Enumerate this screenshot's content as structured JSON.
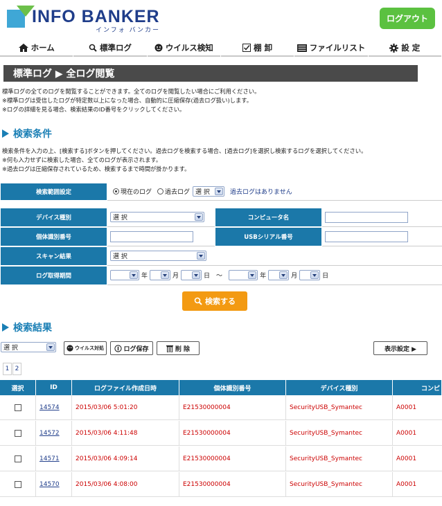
{
  "header": {
    "logo_main": "INFO BANKER",
    "logo_sub": "インフォ バンカー",
    "logout": "ログアウト"
  },
  "nav": [
    {
      "label": "ホーム",
      "icon": "home-icon"
    },
    {
      "label": "標準ログ",
      "icon": "search-icon"
    },
    {
      "label": "ウイルス検知",
      "icon": "smiley-icon"
    },
    {
      "label": "棚 卸",
      "icon": "checkbox-icon"
    },
    {
      "label": "ファイルリスト",
      "icon": "list-icon"
    },
    {
      "label": "設 定",
      "icon": "gear-icon"
    }
  ],
  "page": {
    "title": "標準ログ ▶ 全ログ閲覧",
    "desc": [
      "標準ログの全てのログを閲覧することができます。全てのログを閲覧したい場合にご利用ください。",
      "※標準ログは受信したログが特定数以上になった場合、自動的に圧縮保存(過去ログ扱い)します。",
      "※ログの詳細を見る場合、検索結果のID番号をクリックしてください。"
    ]
  },
  "conditions": {
    "title": "検索条件",
    "desc": [
      "検索条件を入力の上、[検索する]ボタンを押してください。過去ログを検索する場合、[過去ログ]を選択し検索するログを選択してください。",
      "※何も入力せずに検索した場合、全てのログが表示されます。",
      "※過去ログは圧縮保存されているため、検索するまで時間が掛かります。"
    ],
    "range_label": "検索範囲設定",
    "radio_current": "現在のログ",
    "radio_past": "過去ログ",
    "past_select": "選 択",
    "no_past": "過去ログはありません",
    "device_label": "デバイス種別",
    "device_select": "選 択",
    "computer_label": "コンピュータ名",
    "individual_label": "個体識別番号",
    "usb_label": "USBシリアル番号",
    "scan_label": "スキャン結果",
    "scan_select": "選 択",
    "period_label": "ログ取得期間",
    "year": "年",
    "month": "月",
    "day": "日",
    "tilde": "～",
    "search_btn": "検索する"
  },
  "results": {
    "title": "検索結果",
    "bulk_select": "選 択",
    "virus_btn": "ウイルス対処",
    "save_btn": "ログ保存",
    "delete_btn": "削 除",
    "display_btn": "表示設定 ▶",
    "pages": [
      "1",
      "2"
    ],
    "columns": [
      "選択",
      "ID",
      "ログファイル作成日時",
      "個体識別番号",
      "デバイス種別",
      "コンピ"
    ],
    "rows": [
      {
        "id": "14574",
        "date": "2015/03/06 5:01:20",
        "serial": "E21530000004",
        "device": "SecurityUSB_Symantec",
        "pc": "A0001"
      },
      {
        "id": "14572",
        "date": "2015/03/06 4:11:48",
        "serial": "E21530000004",
        "device": "SecurityUSB_Symantec",
        "pc": "A0001"
      },
      {
        "id": "14571",
        "date": "2015/03/06 4:09:14",
        "serial": "E21530000004",
        "device": "SecurityUSB_Symantec",
        "pc": "A0001"
      },
      {
        "id": "14570",
        "date": "2015/03/06 4:08:00",
        "serial": "E21530000004",
        "device": "SecurityUSB_Symantec",
        "pc": "A0001"
      }
    ]
  },
  "colors": {
    "nav_blue": "#1b78a9",
    "logout_green": "#5bc140",
    "search_orange": "#f39a12",
    "title_gray": "#4a4a4a"
  }
}
